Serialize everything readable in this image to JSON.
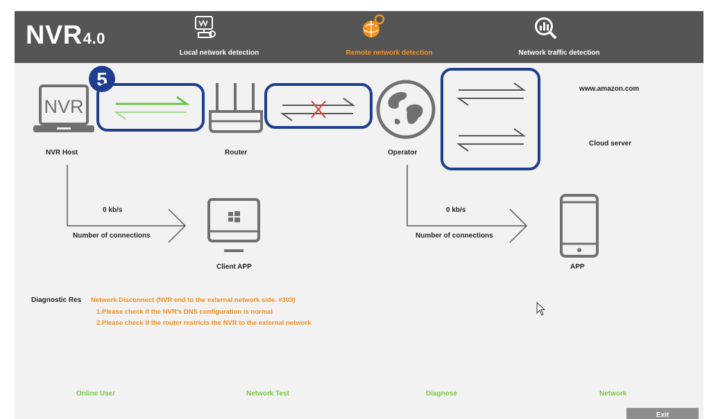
{
  "header": {
    "logo": "NVR",
    "version": "4.0",
    "tabs": [
      {
        "label": "Local network detection",
        "active": false,
        "icon": "local-network-icon"
      },
      {
        "label": "Remote network detection",
        "active": true,
        "icon": "remote-network-icon"
      },
      {
        "label": "Network traffic detection",
        "active": false,
        "icon": "traffic-detection-icon"
      }
    ]
  },
  "step_badge": "5",
  "topology": {
    "nvr_screen": "NVR",
    "nvr_host": "NVR Host",
    "router": "Router",
    "operator": "Operator",
    "cloud_host": "www.amazon.com",
    "cloud_server": "Cloud server"
  },
  "links": {
    "nvr_router": "connected",
    "router_operator": "disconnected",
    "operator_cloud": "connected"
  },
  "local": {
    "speed": "0 kb/s",
    "connections": "Number of connections",
    "client": "Client APP"
  },
  "remote": {
    "speed": "0 kb/s",
    "connections": "Number of connections",
    "client": "APP"
  },
  "diagnostic": {
    "label": "Diagnostic Res",
    "result": "Network Disconnect (NVR end to the external network side.  #303)",
    "tips": [
      "1.Please check if the NVR's DNS configuration is normal",
      "2.Please check if the router restricts the NVR to the external network"
    ]
  },
  "footer": {
    "links": [
      "Online User",
      "Network Test",
      "Diagnose",
      "Network"
    ],
    "exit": "Exit"
  },
  "colors": {
    "header_bg": "#555555",
    "active_tab": "#f7931e",
    "highlight_box": "#1f3d8f",
    "ok_link": "#6cc04a",
    "fail_mark": "#e03a3a",
    "diagnostic_text": "#f28c1e",
    "footer_link": "#7ac943"
  }
}
